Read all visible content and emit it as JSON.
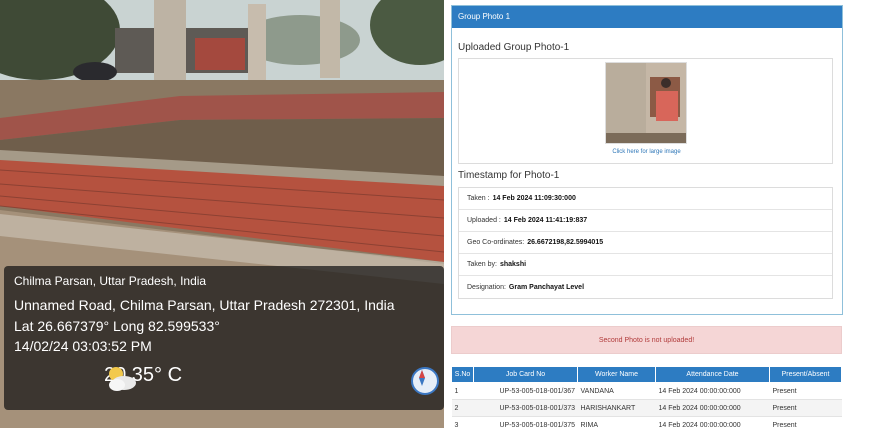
{
  "geo_photo": {
    "place": "Chilma Parsan, Uttar Pradesh, India",
    "address": "Unnamed Road, Chilma Parsan, Uttar Pradesh 272301, India",
    "latlong": "Lat 26.667379° Long 82.599533°",
    "datetime": "14/02/24 03:03:52 PM",
    "temperature": "20.35° C",
    "weather_icon": "partly-cloudy-icon",
    "compass_icon": "compass-icon"
  },
  "panel": {
    "header": "Group Photo 1",
    "uploaded_title": "Uploaded Group Photo-1",
    "photo_link": "Click here for large image",
    "timestamp_title": "Timestamp for Photo-1",
    "rows": [
      {
        "label": "Taken :",
        "value": "14 Feb 2024 11:09:30:000"
      },
      {
        "label": "Uploaded :",
        "value": "14 Feb 2024 11:41:19:837"
      },
      {
        "label": "Geo Co-ordinates:",
        "value": "26.6672198,82.5994015"
      },
      {
        "label": "Taken by:",
        "value": "shakshi"
      },
      {
        "label": "Designation:",
        "value": "Gram Panchayat Level"
      }
    ]
  },
  "alert": {
    "text": "Second Photo is not uploaded!",
    "color": "#b13b3b"
  },
  "table": {
    "headers": [
      "S.No",
      "Job Card No",
      "Worker Name",
      "Attendance Date",
      "Present/Absent"
    ],
    "rows": [
      [
        "1",
        "UP-53-005-018-001/367",
        "VANDANA",
        "14 Feb 2024 00:00:00:000",
        "Present"
      ],
      [
        "2",
        "UP-53-005-018-001/373",
        "HARISHANKART",
        "14 Feb 2024 00:00:00:000",
        "Present"
      ],
      [
        "3",
        "UP-53-005-018-001/375",
        "RIMA",
        "14 Feb 2024 00:00:00:000",
        "Present"
      ]
    ]
  },
  "colors": {
    "header_blue": "#2d7cc2",
    "alert_bg": "#f5d6d6"
  }
}
